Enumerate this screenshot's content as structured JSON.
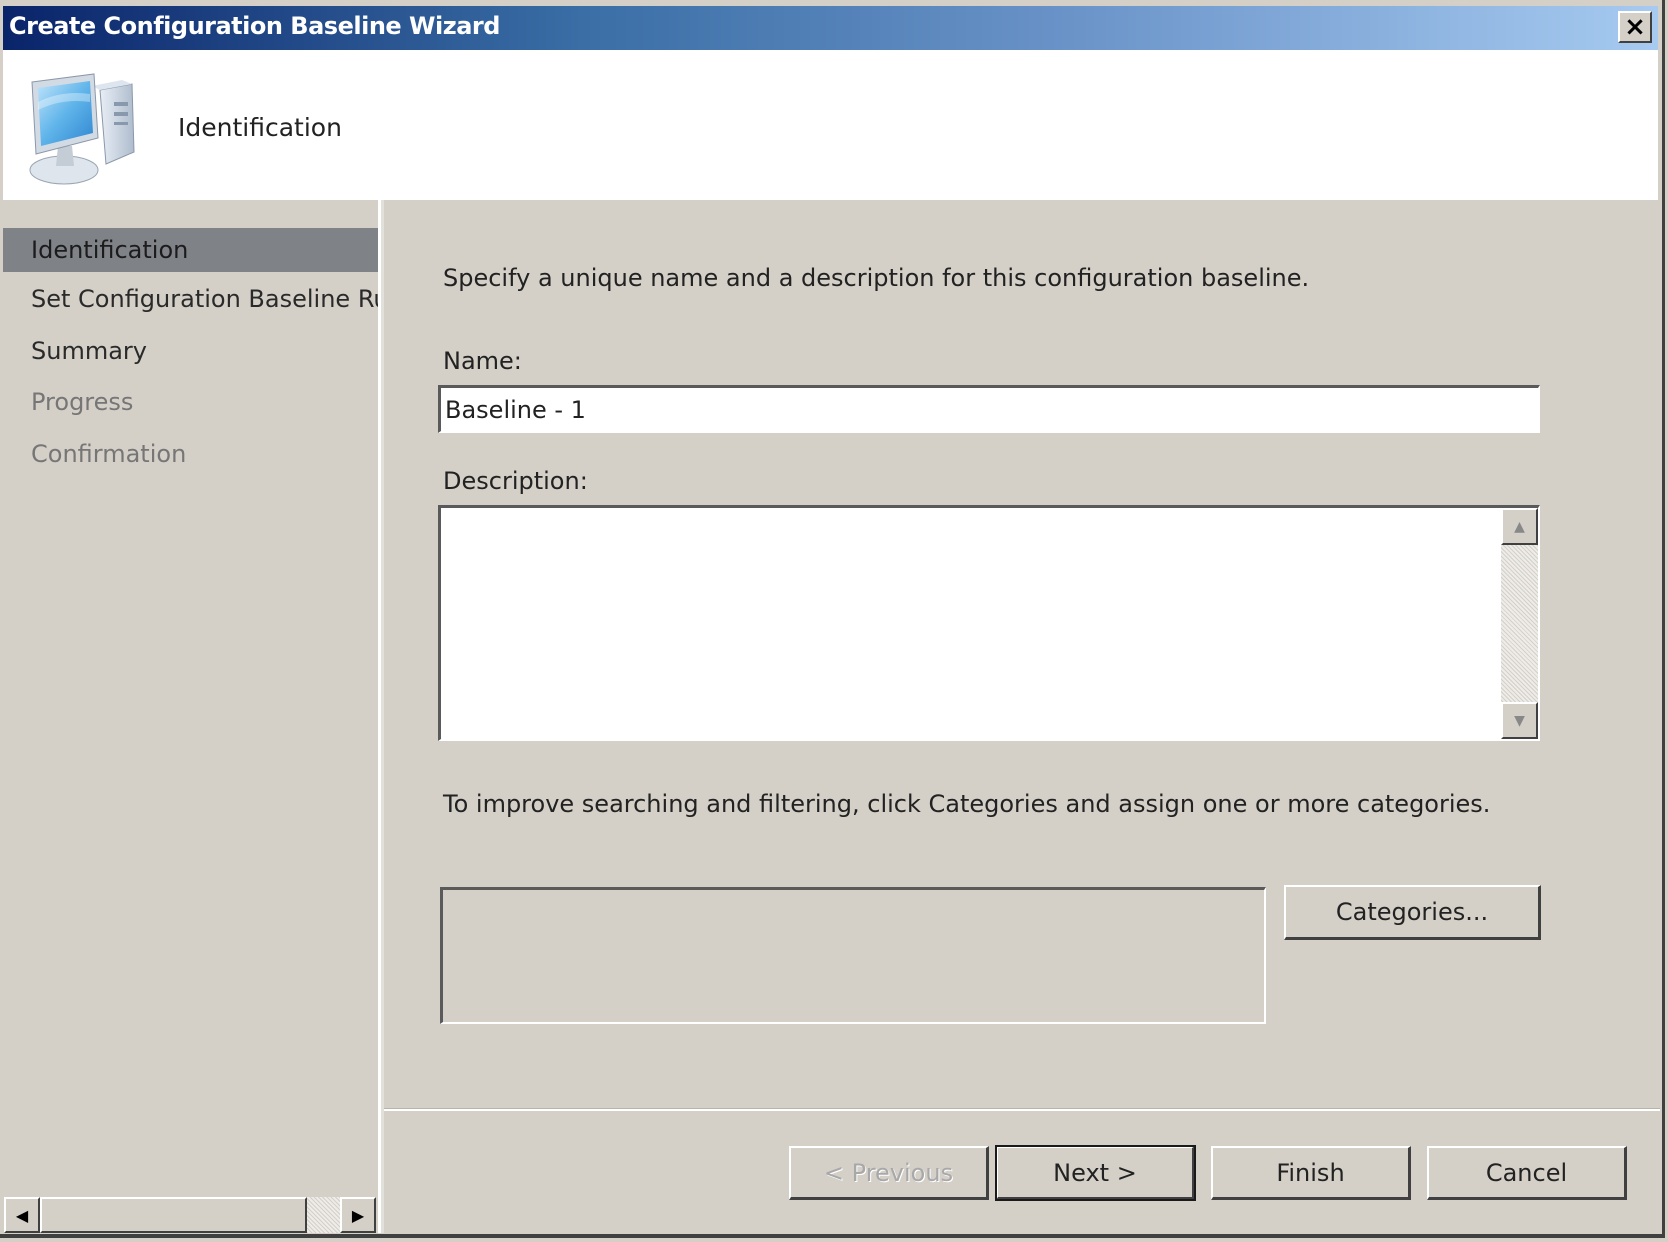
{
  "window": {
    "title": "Create Configuration Baseline Wizard",
    "close_label": "×"
  },
  "header": {
    "icon": "computer-icon",
    "title": "Identification"
  },
  "sidebar": {
    "items": [
      {
        "label": "Identification",
        "state": "selected"
      },
      {
        "label": "Set Configuration Baseline Rules",
        "state": "active"
      },
      {
        "label": "Summary",
        "state": "active"
      },
      {
        "label": "Progress",
        "state": "disabled"
      },
      {
        "label": "Confirmation",
        "state": "disabled"
      }
    ],
    "scroll_left_glyph": "◀",
    "scroll_right_glyph": "▶"
  },
  "main": {
    "intro": "Specify a unique name and a description for this configuration baseline.",
    "name_label": "Name:",
    "name_value": "Baseline - 1",
    "description_label": "Description:",
    "description_value": "",
    "scroll_up_glyph": "▲",
    "scroll_down_glyph": "▼",
    "categories_hint": "To improve searching and filtering, click Categories and assign one or more categories.",
    "categories_button": "Categories..."
  },
  "footer": {
    "previous_label": "< Previous",
    "next_label": "Next >",
    "finish_label": "Finish",
    "cancel_label": "Cancel"
  },
  "colors": {
    "titlebar_start": "#0a246a",
    "titlebar_end": "#a6caf0",
    "dialog_bg": "#d4d0c8",
    "selected_nav_bg": "#7f8287"
  }
}
